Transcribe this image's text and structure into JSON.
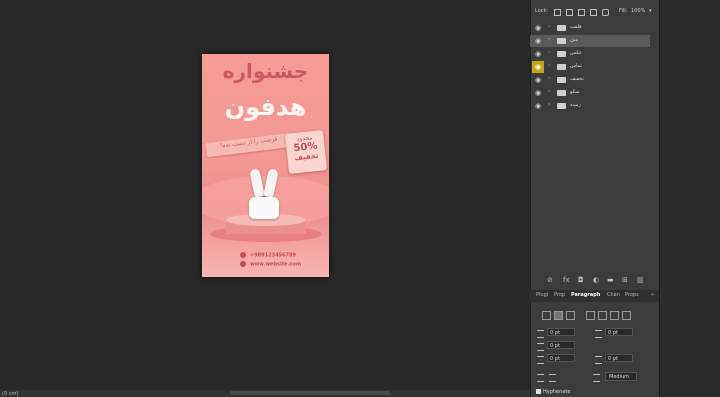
{
  "canvas": {
    "zoom_label": "(0 cm)"
  },
  "poster": {
    "title_line1": "جشنواره",
    "title_line2": "هدفون",
    "ribbon_text": "فرصت را از دست نده!",
    "badge_top": "محدود",
    "badge_value": "50%",
    "badge_label": "تخفیف",
    "phone": "+989123456789",
    "website": "www.website.com"
  },
  "layers_panel": {
    "lock_label": "Lock:",
    "fill_label": "Fill:",
    "fill_value": "100%",
    "layers": [
      {
        "name": "قلقت",
        "visible": true,
        "highlight": false,
        "selected": false
      },
      {
        "name": "متن",
        "visible": true,
        "highlight": false,
        "selected": true
      },
      {
        "name": "عکس",
        "visible": true,
        "highlight": false,
        "selected": false
      },
      {
        "name": "تماس",
        "visible": true,
        "highlight": true,
        "selected": false
      },
      {
        "name": "تخفیف",
        "visible": true,
        "highlight": false,
        "selected": false
      },
      {
        "name": "سکو",
        "visible": true,
        "highlight": false,
        "selected": false
      },
      {
        "name": "زمینه",
        "visible": true,
        "highlight": false,
        "selected": false
      }
    ],
    "bottom_icons": [
      "link-icon",
      "fx-icon",
      "mask-icon",
      "adjustment-icon",
      "group-icon",
      "new-layer-icon",
      "trash-icon"
    ]
  },
  "paragraph_panel": {
    "tabs": [
      "Plugi",
      "Prop",
      "Paragraph",
      "Chan",
      "Props"
    ],
    "active_tab": "Paragraph",
    "fields": {
      "indent_left": "0 pt",
      "indent_right": "0 pt",
      "first_line": "0 pt",
      "space_before": "0 pt",
      "space_after": "0 pt"
    },
    "composer_value": "Medium",
    "hyphenate_label": "Hyphenate",
    "hyphenate_checked": true
  }
}
